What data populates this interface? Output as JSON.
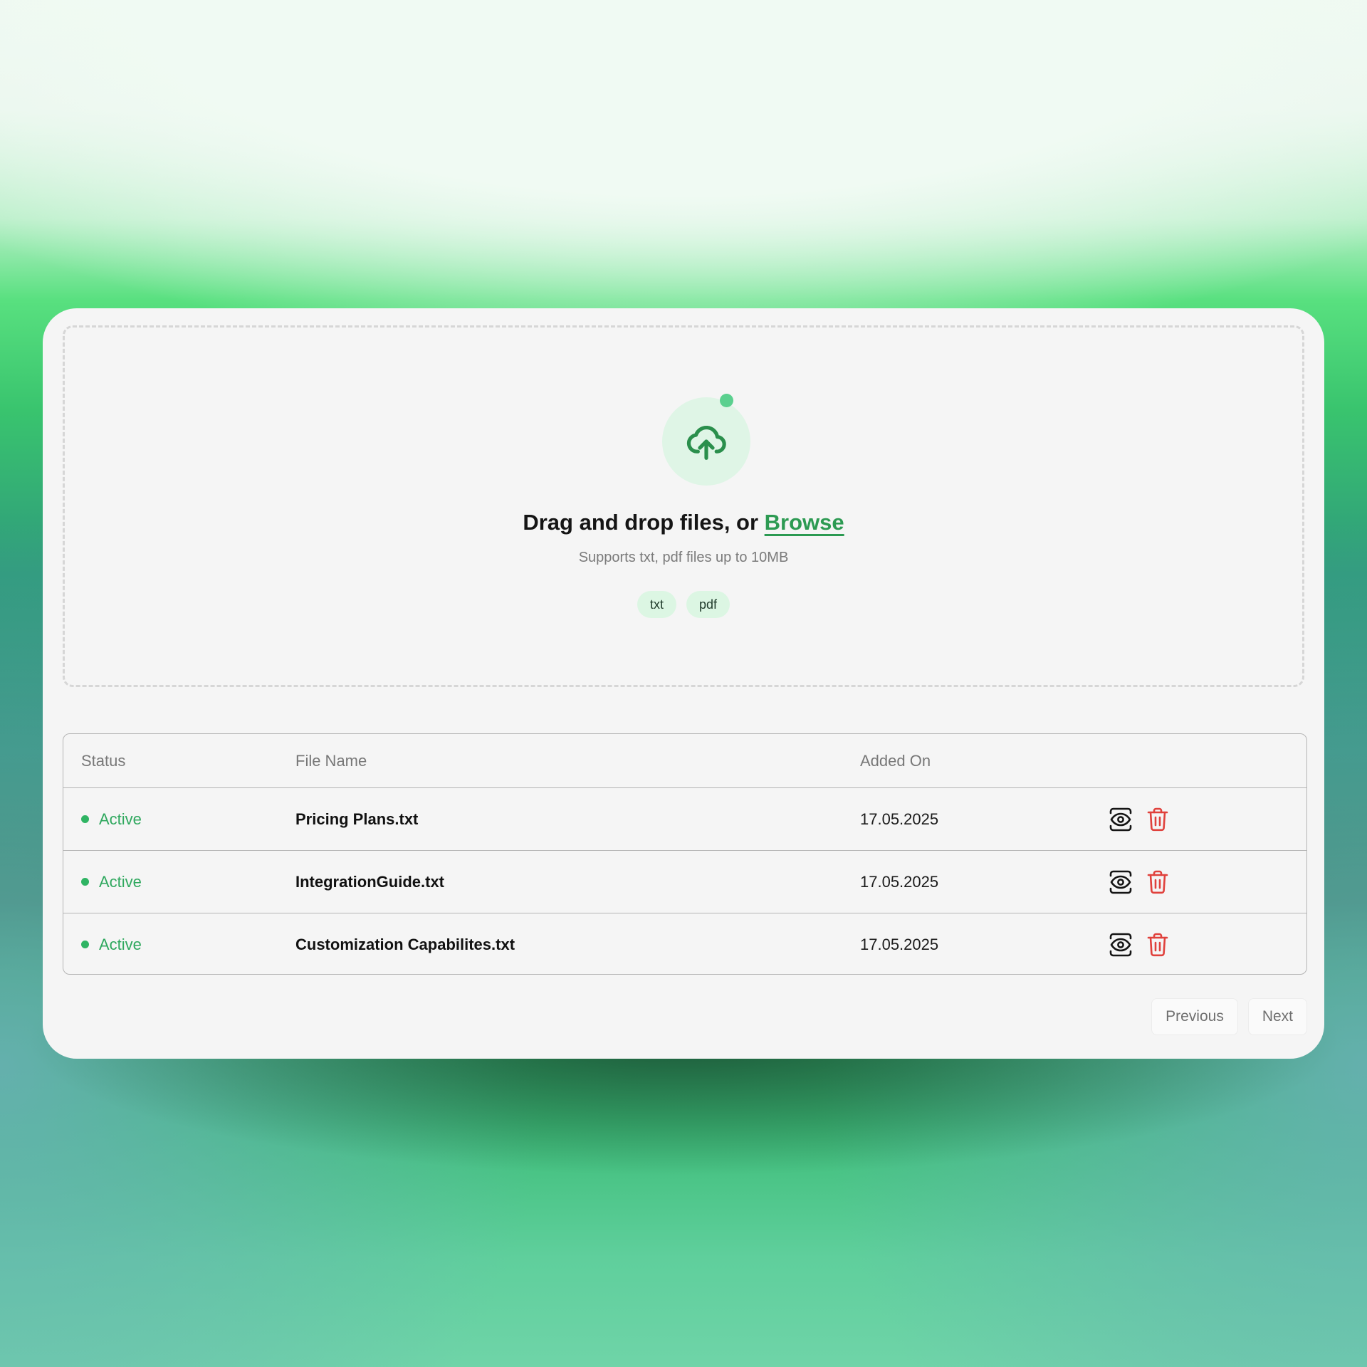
{
  "upload": {
    "title_prefix": "Drag and drop files, or ",
    "browse_label": "Browse",
    "subtitle": "Supports txt, pdf files up to 10MB",
    "file_types": [
      "txt",
      "pdf"
    ]
  },
  "table": {
    "headers": {
      "status": "Status",
      "file_name": "File Name",
      "added_on": "Added On"
    },
    "rows": [
      {
        "status": "Active",
        "file_name": "Pricing Plans.txt",
        "added_on": "17.05.2025"
      },
      {
        "status": "Active",
        "file_name": "IntegrationGuide.txt",
        "added_on": "17.05.2025"
      },
      {
        "status": "Active",
        "file_name": "Customization Capabilites.txt",
        "added_on": "17.05.2025"
      }
    ],
    "row_actions": [
      "view-icon",
      "trash-icon"
    ]
  },
  "pagination": {
    "previous_label": "Previous",
    "next_label": "Next"
  },
  "colors": {
    "accent": "#2c9a52",
    "status_active": "#2fb463",
    "danger": "#e0413c",
    "chip_bg": "#dcf6e3"
  }
}
